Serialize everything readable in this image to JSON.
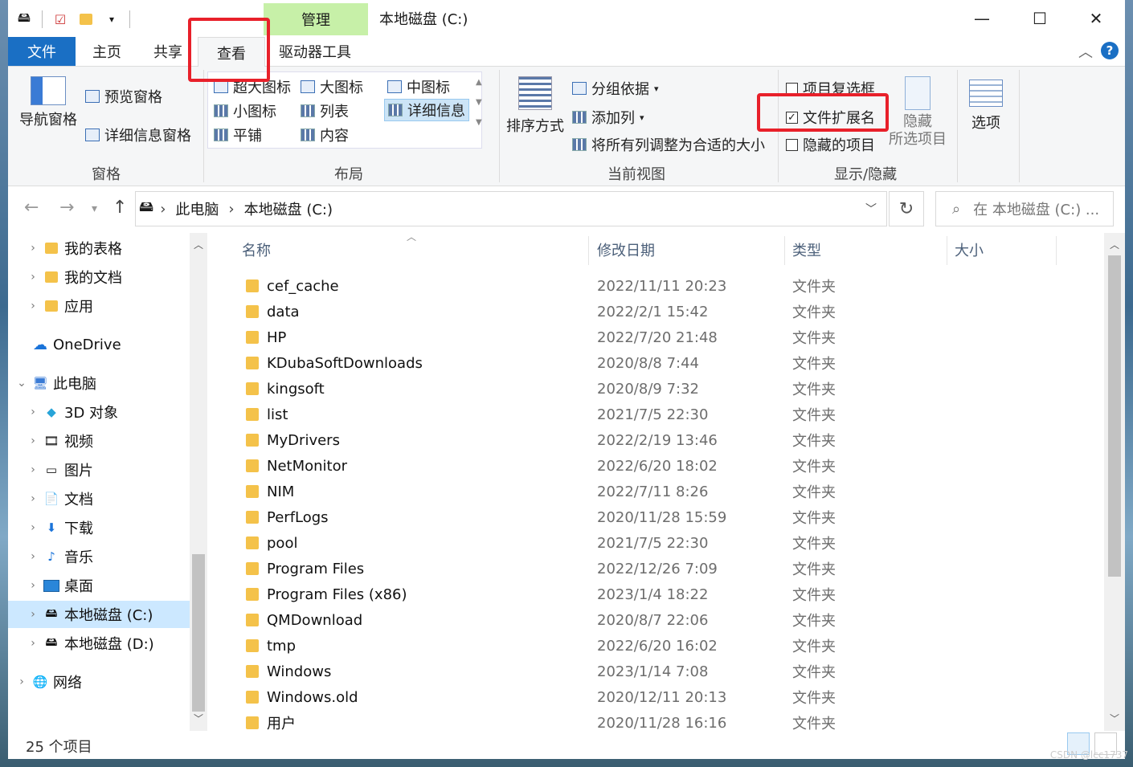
{
  "window": {
    "title": "本地磁盘 (C:)",
    "context_tab_header": "管理",
    "minimize": "—",
    "maximize": "☐",
    "close": "✕"
  },
  "tabs": [
    {
      "label": "文件"
    },
    {
      "label": "主页"
    },
    {
      "label": "共享"
    },
    {
      "label": "查看"
    },
    {
      "label": "驱动器工具"
    }
  ],
  "ribbon": {
    "panes": {
      "nav_pane": "导航窗格",
      "preview_pane": "预览窗格",
      "details_pane": "详细信息窗格",
      "group_label": "窗格"
    },
    "layout": {
      "items": [
        "超大图标",
        "大图标",
        "中图标",
        "小图标",
        "列表",
        "详细信息",
        "平铺",
        "内容"
      ],
      "group_label": "布局"
    },
    "current_view": {
      "sort_by": "排序方式",
      "group_by": "分组依据",
      "add_column": "添加列",
      "fit_columns": "将所有列调整为合适的大小",
      "group_label": "当前视图"
    },
    "show_hide": {
      "item_checkboxes": "项目复选框",
      "file_extensions": "文件扩展名",
      "hidden_items": "隐藏的项目",
      "hide_selected_1": "隐藏",
      "hide_selected_2": "所选项目",
      "options": "选项",
      "group_label": "显示/隐藏",
      "file_extensions_checked": true
    }
  },
  "address": {
    "crumbs": [
      "此电脑",
      "本地磁盘 (C:)"
    ],
    "search_placeholder": "在 本地磁盘 (C:) ..."
  },
  "nav": [
    {
      "label": "我的表格",
      "level": 1
    },
    {
      "label": "我的文档",
      "level": 1
    },
    {
      "label": "应用",
      "level": 1
    },
    {
      "label": "OneDrive",
      "level": 0
    },
    {
      "label": "此电脑",
      "level": 0
    },
    {
      "label": "3D 对象",
      "level": 1
    },
    {
      "label": "视频",
      "level": 1
    },
    {
      "label": "图片",
      "level": 1
    },
    {
      "label": "文档",
      "level": 1
    },
    {
      "label": "下载",
      "level": 1
    },
    {
      "label": "音乐",
      "level": 1
    },
    {
      "label": "桌面",
      "level": 1
    },
    {
      "label": "本地磁盘 (C:)",
      "level": 1
    },
    {
      "label": "本地磁盘 (D:)",
      "level": 1
    },
    {
      "label": "网络",
      "level": 0
    }
  ],
  "columns": {
    "name": "名称",
    "date": "修改日期",
    "type": "类型",
    "size": "大小"
  },
  "files": [
    {
      "name": "cef_cache",
      "date": "2022/11/11 20:23",
      "type": "文件夹"
    },
    {
      "name": "data",
      "date": "2022/2/1 15:42",
      "type": "文件夹"
    },
    {
      "name": "HP",
      "date": "2022/7/20 21:48",
      "type": "文件夹"
    },
    {
      "name": "KDubaSoftDownloads",
      "date": "2020/8/8 7:44",
      "type": "文件夹"
    },
    {
      "name": "kingsoft",
      "date": "2020/8/9 7:32",
      "type": "文件夹"
    },
    {
      "name": "list",
      "date": "2021/7/5 22:30",
      "type": "文件夹"
    },
    {
      "name": "MyDrivers",
      "date": "2022/2/19 13:46",
      "type": "文件夹"
    },
    {
      "name": "NetMonitor",
      "date": "2022/6/20 18:02",
      "type": "文件夹"
    },
    {
      "name": "NIM",
      "date": "2022/7/11 8:26",
      "type": "文件夹"
    },
    {
      "name": "PerfLogs",
      "date": "2020/11/28 15:59",
      "type": "文件夹"
    },
    {
      "name": "pool",
      "date": "2021/7/5 22:30",
      "type": "文件夹"
    },
    {
      "name": "Program Files",
      "date": "2022/12/26 7:09",
      "type": "文件夹"
    },
    {
      "name": "Program Files (x86)",
      "date": "2023/1/4 18:22",
      "type": "文件夹"
    },
    {
      "name": "QMDownload",
      "date": "2020/8/7 22:06",
      "type": "文件夹"
    },
    {
      "name": "tmp",
      "date": "2022/6/20 16:02",
      "type": "文件夹"
    },
    {
      "name": "Windows",
      "date": "2023/1/14 7:08",
      "type": "文件夹"
    },
    {
      "name": "Windows.old",
      "date": "2020/12/11 20:13",
      "type": "文件夹"
    },
    {
      "name": "用户",
      "date": "2020/11/28 16:16",
      "type": "文件夹"
    }
  ],
  "status": {
    "count": "25 个项目"
  },
  "watermark": "CSDN @lcc1737"
}
